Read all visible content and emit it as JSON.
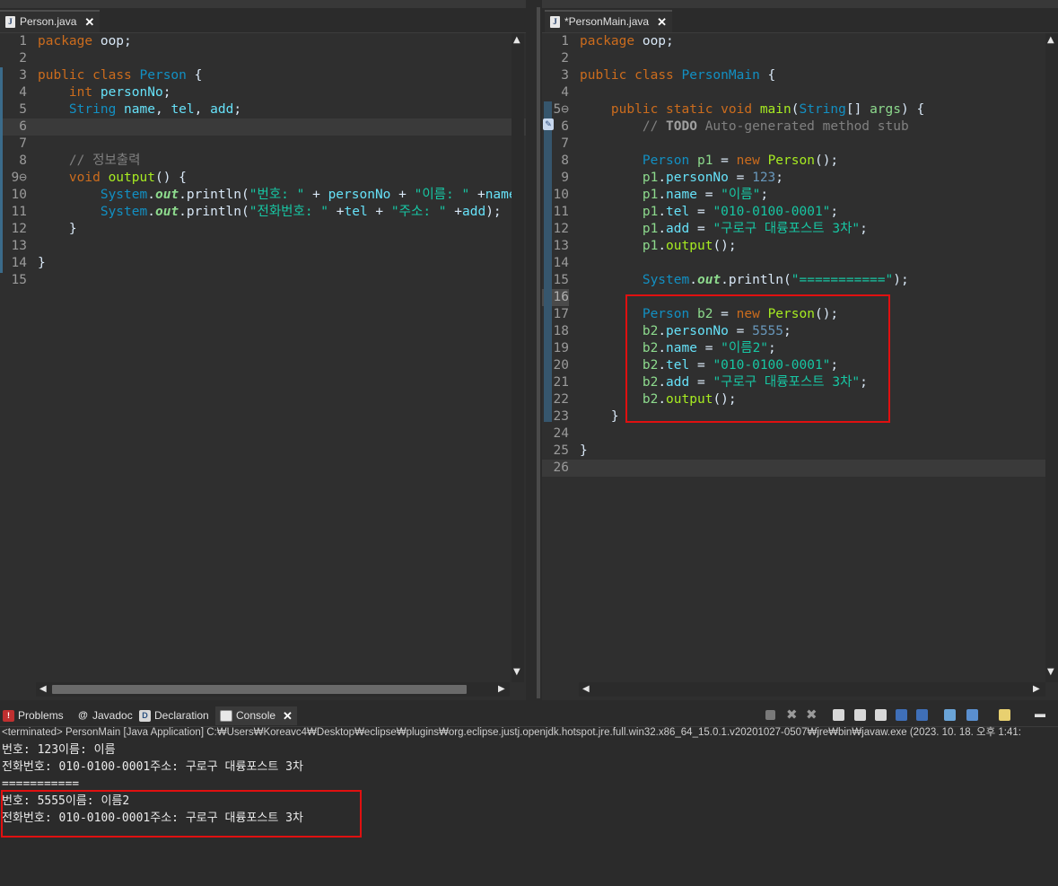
{
  "left_editor": {
    "tab_label": "Person.java",
    "lines": [
      {
        "n": "1",
        "tokens": [
          [
            "k",
            "package"
          ],
          [
            "p",
            " oop;"
          ]
        ]
      },
      {
        "n": "2",
        "tokens": []
      },
      {
        "n": "3",
        "tokens": [
          [
            "k",
            "public"
          ],
          [
            "p",
            " "
          ],
          [
            "k",
            "class"
          ],
          [
            "p",
            " "
          ],
          [
            "t",
            "Person"
          ],
          [
            "p",
            " {"
          ]
        ]
      },
      {
        "n": "4",
        "tokens": [
          [
            "p",
            "    "
          ],
          [
            "k",
            "int"
          ],
          [
            "p",
            " "
          ],
          [
            "f",
            "personNo"
          ],
          [
            "p",
            ";"
          ]
        ]
      },
      {
        "n": "5",
        "tokens": [
          [
            "p",
            "    "
          ],
          [
            "t",
            "String"
          ],
          [
            "p",
            " "
          ],
          [
            "f",
            "name"
          ],
          [
            "p",
            ", "
          ],
          [
            "f",
            "tel"
          ],
          [
            "p",
            ", "
          ],
          [
            "f",
            "add"
          ],
          [
            "p",
            ";"
          ]
        ]
      },
      {
        "n": "6",
        "tokens": []
      },
      {
        "n": "7",
        "tokens": []
      },
      {
        "n": "8",
        "tokens": [
          [
            "p",
            "    "
          ],
          [
            "cm",
            "// 정보출력"
          ]
        ]
      },
      {
        "n": "9⊖",
        "tokens": [
          [
            "p",
            "    "
          ],
          [
            "k",
            "void"
          ],
          [
            "p",
            " "
          ],
          [
            "m",
            "output"
          ],
          [
            "p",
            "() {"
          ]
        ]
      },
      {
        "n": "10",
        "tokens": [
          [
            "p",
            "        "
          ],
          [
            "t",
            "System"
          ],
          [
            "p",
            "."
          ],
          [
            "st",
            "out"
          ],
          [
            "p",
            ".println("
          ],
          [
            "s",
            "\"번호: \""
          ],
          [
            "p",
            " + "
          ],
          [
            "f",
            "personNo"
          ],
          [
            "p",
            " + "
          ],
          [
            "s",
            "\"이름: \""
          ],
          [
            "p",
            " +"
          ],
          [
            "f",
            "name"
          ],
          [
            "p",
            ");"
          ]
        ]
      },
      {
        "n": "11",
        "tokens": [
          [
            "p",
            "        "
          ],
          [
            "t",
            "System"
          ],
          [
            "p",
            "."
          ],
          [
            "st",
            "out"
          ],
          [
            "p",
            ".println("
          ],
          [
            "s",
            "\"전화번호: \""
          ],
          [
            "p",
            " +"
          ],
          [
            "f",
            "tel"
          ],
          [
            "p",
            " + "
          ],
          [
            "s",
            "\"주소: \""
          ],
          [
            "p",
            " +"
          ],
          [
            "f",
            "add"
          ],
          [
            "p",
            ");"
          ]
        ]
      },
      {
        "n": "12",
        "tokens": [
          [
            "p",
            "    }"
          ]
        ]
      },
      {
        "n": "13",
        "tokens": []
      },
      {
        "n": "14",
        "tokens": [
          [
            "p",
            "}"
          ]
        ]
      },
      {
        "n": "15",
        "tokens": []
      }
    ]
  },
  "right_editor": {
    "tab_label": "*PersonMain.java",
    "lines": [
      {
        "n": "1",
        "tokens": [
          [
            "k",
            "package"
          ],
          [
            "p",
            " oop;"
          ]
        ]
      },
      {
        "n": "2",
        "tokens": []
      },
      {
        "n": "3",
        "tokens": [
          [
            "k",
            "public"
          ],
          [
            "p",
            " "
          ],
          [
            "k",
            "class"
          ],
          [
            "p",
            " "
          ],
          [
            "t",
            "PersonMain"
          ],
          [
            "p",
            " {"
          ]
        ]
      },
      {
        "n": "4",
        "tokens": []
      },
      {
        "n": "5⊖",
        "tokens": [
          [
            "p",
            "    "
          ],
          [
            "k",
            "public"
          ],
          [
            "p",
            " "
          ],
          [
            "k",
            "static"
          ],
          [
            "p",
            " "
          ],
          [
            "k",
            "void"
          ],
          [
            "p",
            " "
          ],
          [
            "m",
            "main"
          ],
          [
            "p",
            "("
          ],
          [
            "t",
            "String"
          ],
          [
            "p",
            "[] "
          ],
          [
            "sv",
            "args"
          ],
          [
            "p",
            ") {"
          ]
        ]
      },
      {
        "n": "6",
        "tokens": [
          [
            "p",
            "        "
          ],
          [
            "cm",
            "// "
          ],
          [
            "todo",
            "TODO"
          ],
          [
            "cm",
            " Auto-generated method stub"
          ]
        ]
      },
      {
        "n": "7",
        "tokens": []
      },
      {
        "n": "8",
        "tokens": [
          [
            "p",
            "        "
          ],
          [
            "t",
            "Person"
          ],
          [
            "p",
            " "
          ],
          [
            "sv",
            "p1"
          ],
          [
            "p",
            " = "
          ],
          [
            "k",
            "new"
          ],
          [
            "p",
            " "
          ],
          [
            "m",
            "Person"
          ],
          [
            "p",
            "();"
          ]
        ]
      },
      {
        "n": "9",
        "tokens": [
          [
            "p",
            "        "
          ],
          [
            "sv",
            "p1"
          ],
          [
            "p",
            "."
          ],
          [
            "f",
            "personNo"
          ],
          [
            "p",
            " = "
          ],
          [
            "n",
            "123"
          ],
          [
            "p",
            ";"
          ]
        ]
      },
      {
        "n": "10",
        "tokens": [
          [
            "p",
            "        "
          ],
          [
            "sv",
            "p1"
          ],
          [
            "p",
            "."
          ],
          [
            "f",
            "name"
          ],
          [
            "p",
            " = "
          ],
          [
            "s",
            "\"이름\""
          ],
          [
            "p",
            ";"
          ]
        ]
      },
      {
        "n": "11",
        "tokens": [
          [
            "p",
            "        "
          ],
          [
            "sv",
            "p1"
          ],
          [
            "p",
            "."
          ],
          [
            "f",
            "tel"
          ],
          [
            "p",
            " = "
          ],
          [
            "s",
            "\"010-0100-0001\""
          ],
          [
            "p",
            ";"
          ]
        ]
      },
      {
        "n": "12",
        "tokens": [
          [
            "p",
            "        "
          ],
          [
            "sv",
            "p1"
          ],
          [
            "p",
            "."
          ],
          [
            "f",
            "add"
          ],
          [
            "p",
            " = "
          ],
          [
            "s",
            "\"구로구 대륭포스트 3차\""
          ],
          [
            "p",
            ";"
          ]
        ]
      },
      {
        "n": "13",
        "tokens": [
          [
            "p",
            "        "
          ],
          [
            "sv",
            "p1"
          ],
          [
            "p",
            "."
          ],
          [
            "m",
            "output"
          ],
          [
            "p",
            "();"
          ]
        ]
      },
      {
        "n": "14",
        "tokens": []
      },
      {
        "n": "15",
        "tokens": [
          [
            "p",
            "        "
          ],
          [
            "t",
            "System"
          ],
          [
            "p",
            "."
          ],
          [
            "st",
            "out"
          ],
          [
            "p",
            ".println("
          ],
          [
            "s",
            "\"===========\""
          ],
          [
            "p",
            ");"
          ]
        ]
      },
      {
        "n": "16",
        "tokens": []
      },
      {
        "n": "17",
        "tokens": [
          [
            "p",
            "        "
          ],
          [
            "t",
            "Person"
          ],
          [
            "p",
            " "
          ],
          [
            "sv",
            "b2"
          ],
          [
            "p",
            " = "
          ],
          [
            "k",
            "new"
          ],
          [
            "p",
            " "
          ],
          [
            "m",
            "Person"
          ],
          [
            "p",
            "();"
          ]
        ]
      },
      {
        "n": "18",
        "tokens": [
          [
            "p",
            "        "
          ],
          [
            "sv",
            "b2"
          ],
          [
            "p",
            "."
          ],
          [
            "f",
            "personNo"
          ],
          [
            "p",
            " = "
          ],
          [
            "n",
            "5555"
          ],
          [
            "p",
            ";"
          ]
        ]
      },
      {
        "n": "19",
        "tokens": [
          [
            "p",
            "        "
          ],
          [
            "sv",
            "b2"
          ],
          [
            "p",
            "."
          ],
          [
            "f",
            "name"
          ],
          [
            "p",
            " = "
          ],
          [
            "s",
            "\"이름2\""
          ],
          [
            "p",
            ";"
          ]
        ]
      },
      {
        "n": "20",
        "tokens": [
          [
            "p",
            "        "
          ],
          [
            "sv",
            "b2"
          ],
          [
            "p",
            "."
          ],
          [
            "f",
            "tel"
          ],
          [
            "p",
            " = "
          ],
          [
            "s",
            "\"010-0100-0001\""
          ],
          [
            "p",
            ";"
          ]
        ]
      },
      {
        "n": "21",
        "tokens": [
          [
            "p",
            "        "
          ],
          [
            "sv",
            "b2"
          ],
          [
            "p",
            "."
          ],
          [
            "f",
            "add"
          ],
          [
            "p",
            " = "
          ],
          [
            "s",
            "\"구로구 대륭포스트 3차\""
          ],
          [
            "p",
            ";"
          ]
        ]
      },
      {
        "n": "22",
        "tokens": [
          [
            "p",
            "        "
          ],
          [
            "sv",
            "b2"
          ],
          [
            "p",
            "."
          ],
          [
            "m",
            "output"
          ],
          [
            "p",
            "();"
          ]
        ]
      },
      {
        "n": "23",
        "tokens": [
          [
            "p",
            "    }"
          ]
        ]
      },
      {
        "n": "24",
        "tokens": []
      },
      {
        "n": "25",
        "tokens": [
          [
            "p",
            "}"
          ]
        ]
      },
      {
        "n": "26",
        "tokens": []
      }
    ]
  },
  "bottom_panel": {
    "tabs": [
      {
        "label": "Problems",
        "icon": "problems-icon"
      },
      {
        "label": "Javadoc",
        "icon": "javadoc-icon"
      },
      {
        "label": "Declaration",
        "icon": "declaration-icon"
      },
      {
        "label": "Console",
        "icon": "console-icon"
      }
    ],
    "status": "<terminated> PersonMain [Java Application] C:₩Users₩Koreavc4₩Desktop₩eclipse₩plugins₩org.eclipse.justj.openjdk.hotspot.jre.full.win32.x86_64_15.0.1.v20201027-0507₩jre₩bin₩javaw.exe  (2023. 10. 18. 오후 1:41:",
    "output": [
      "번호: 123이름: 이름",
      "전화번호: 010-0100-0001주소: 구로구 대륭포스트 3차",
      "===========",
      "번호: 5555이름: 이름2",
      "전화번호: 010-0100-0001주소: 구로구 대륭포스트 3차"
    ]
  },
  "colors": {
    "keyword": "#cc6c1d",
    "type": "#1290c3",
    "field": "#66e1f8",
    "string": "#17c6a3",
    "highlight_box": "#e01010"
  }
}
